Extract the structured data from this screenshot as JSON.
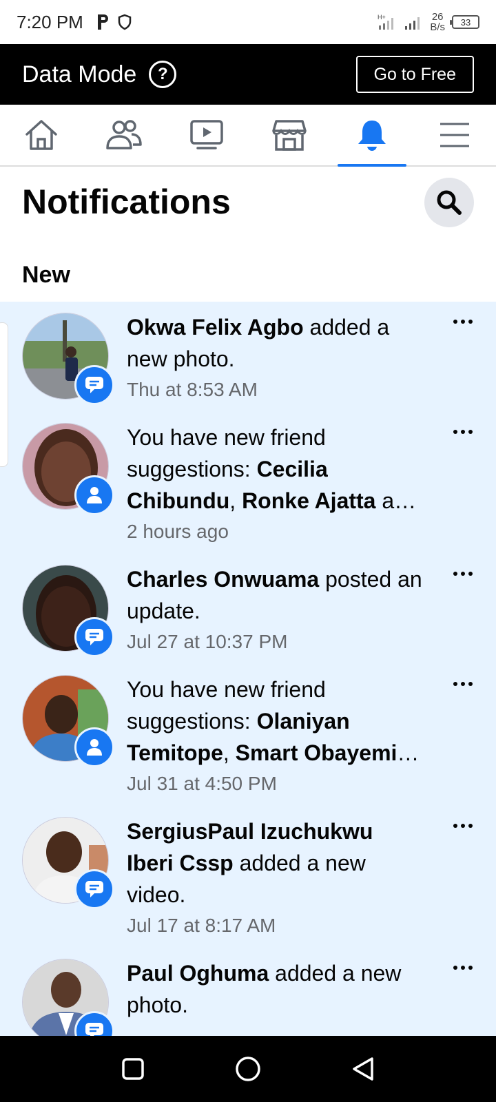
{
  "status_bar": {
    "time": "7:20 PM",
    "net_speed_value": "26",
    "net_speed_unit": "B/s",
    "battery": "33"
  },
  "data_mode": {
    "title": "Data Mode",
    "go_free_label": "Go to Free"
  },
  "nav": {
    "tabs": [
      "home-icon",
      "friends-icon",
      "watch-icon",
      "marketplace-icon",
      "notifications-icon",
      "menu-icon"
    ],
    "active_index": 4,
    "accent": "#1877f2"
  },
  "header": {
    "title": "Notifications",
    "section": "New"
  },
  "notifications": [
    {
      "pre": "",
      "bold1": "Okwa Felix Agbo",
      "mid": " added a new photo.",
      "bold2": "",
      "post": "",
      "time": "Thu at 8:53 AM",
      "badge": "comment"
    },
    {
      "pre": "You have new friend suggestions: ",
      "bold1": "Cecilia Chibundu",
      "mid": ", ",
      "bold2": "Ronke Ajatta",
      "post": " a…",
      "time": "2 hours ago",
      "badge": "person"
    },
    {
      "pre": "",
      "bold1": "Charles Onwuama",
      "mid": " posted an update.",
      "bold2": "",
      "post": "",
      "time": "Jul 27 at 10:37 PM",
      "badge": "comment"
    },
    {
      "pre": "You have new friend suggestions: ",
      "bold1": "Olaniyan Temitope",
      "mid": ", ",
      "bold2": "Smart Obayemi",
      "post": "…",
      "time": "Jul 31 at 4:50 PM",
      "badge": "person"
    },
    {
      "pre": "",
      "bold1": "SergiusPaul Izuchukwu Iberi Cssp",
      "mid": " added a new video.",
      "bold2": "",
      "post": "",
      "time": "Jul 17 at 8:17 AM",
      "badge": "comment"
    },
    {
      "pre": "",
      "bold1": "Paul Oghuma",
      "mid": " added a new photo.",
      "bold2": "",
      "post": "",
      "time": "",
      "badge": "comment"
    }
  ]
}
